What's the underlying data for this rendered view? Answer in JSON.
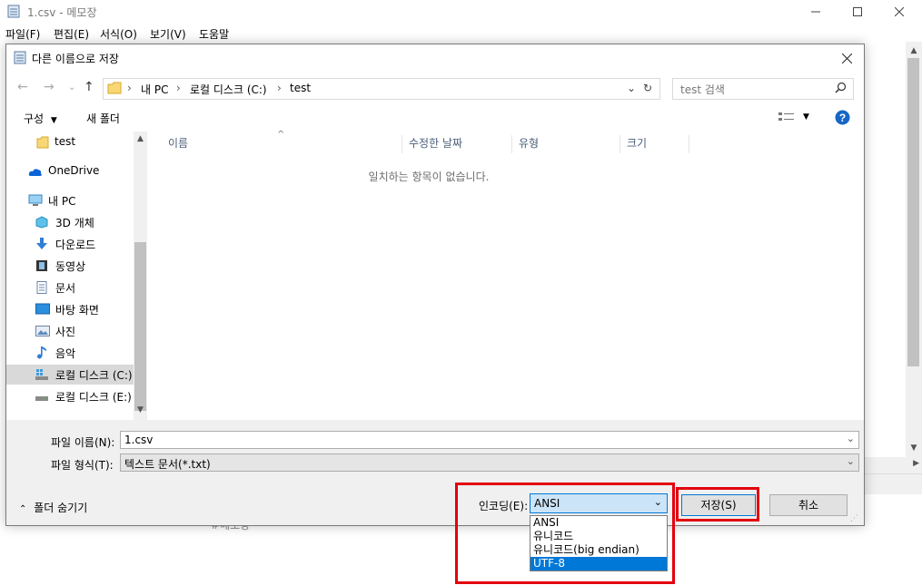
{
  "notepad": {
    "title": "1.csv - 메모장",
    "menu": [
      "파일(F)",
      "편집(E)",
      "서식(O)",
      "보기(V)",
      "도움말"
    ],
    "bottom_text": "#메모장"
  },
  "dialog": {
    "title": "다른 이름으로 저장",
    "breadcrumb": [
      "내 PC",
      "로컬 디스크 (C:)",
      "test"
    ],
    "search_placeholder": "test 검색",
    "toolbar": {
      "organize": "구성",
      "new_folder": "새 폴더"
    },
    "nav": [
      {
        "label": "test",
        "icon": "folder-icon"
      },
      {
        "label": "OneDrive",
        "icon": "cloud-icon"
      },
      {
        "label": "내 PC",
        "icon": "computer-icon"
      },
      {
        "label": "3D 개체",
        "icon": "cube-icon"
      },
      {
        "label": "다운로드",
        "icon": "download-icon"
      },
      {
        "label": "동영상",
        "icon": "video-icon"
      },
      {
        "label": "문서",
        "icon": "document-icon"
      },
      {
        "label": "바탕 화면",
        "icon": "desktop-icon"
      },
      {
        "label": "사진",
        "icon": "picture-icon"
      },
      {
        "label": "음악",
        "icon": "music-icon"
      },
      {
        "label": "로컬 디스크 (C:)",
        "icon": "drive-icon",
        "selected": true
      },
      {
        "label": "로컬 디스크 (E:)",
        "icon": "drive-icon"
      }
    ],
    "columns": [
      "이름",
      "수정한 날짜",
      "유형",
      "크기"
    ],
    "empty_message": "일치하는 항목이 없습니다.",
    "filename_label": "파일 이름(N):",
    "filename_value": "1.csv",
    "filetype_label": "파일 형식(T):",
    "filetype_value": "텍스트 문서(*.txt)",
    "hide_folders": "폴더 숨기기",
    "encoding_label": "인코딩(E):",
    "encoding_value": "ANSI",
    "encoding_options": [
      "ANSI",
      "유니코드",
      "유니코드(big endian)",
      "UTF-8"
    ],
    "encoding_highlighted": "UTF-8",
    "save_button": "저장(S)",
    "cancel_button": "취소"
  },
  "colors": {
    "highlight": "#e3000f",
    "accent": "#0078d7"
  }
}
